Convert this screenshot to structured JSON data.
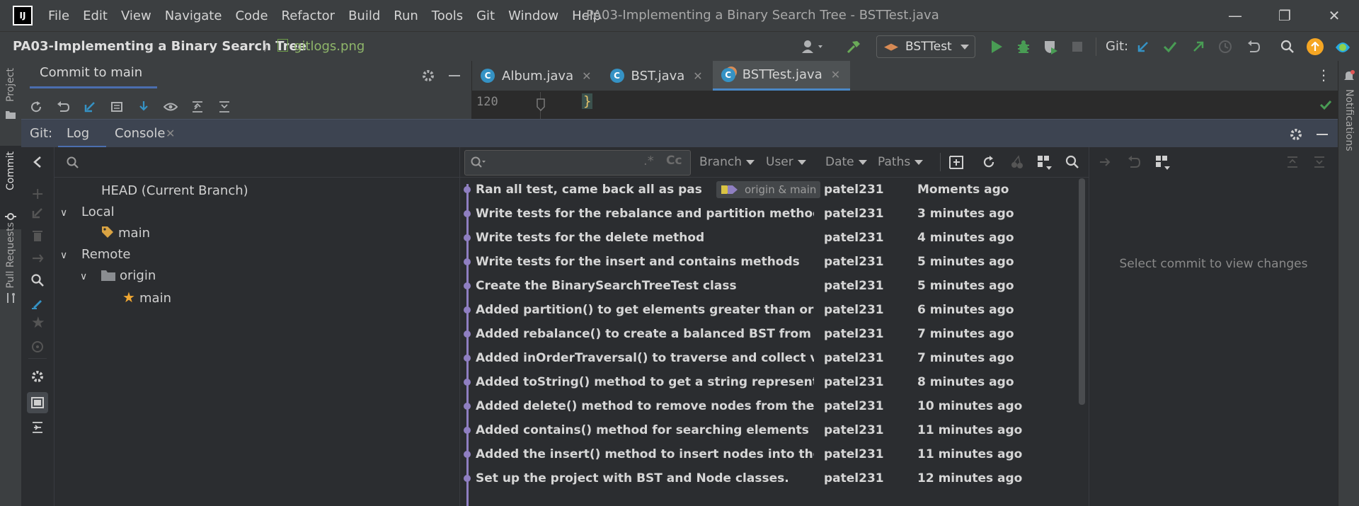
{
  "menubar": {
    "items": [
      "File",
      "Edit",
      "View",
      "Navigate",
      "Code",
      "Refactor",
      "Build",
      "Run",
      "Tools",
      "Git",
      "Window",
      "Help"
    ],
    "window_title": "PA03-Implementing a Binary Search Tree - BSTTest.java"
  },
  "navbar": {
    "project": "PA03-Implementing a Binary Search Tree",
    "file": "gitlogs.png",
    "run_config": "BSTTest",
    "git_label": "Git:"
  },
  "stripes": {
    "left": [
      "Project",
      "Commit",
      "Pull Requests"
    ],
    "right": [
      "Notifications"
    ]
  },
  "commit_panel": {
    "title": "Commit to main"
  },
  "editor": {
    "tabs": [
      {
        "label": "Album.java",
        "active": false
      },
      {
        "label": "BST.java",
        "active": false
      },
      {
        "label": "BSTTest.java",
        "active": true
      }
    ],
    "line_number": "120",
    "code": "}"
  },
  "git": {
    "label": "Git:",
    "tabs": [
      "Log",
      "Console"
    ],
    "branches": {
      "head": "HEAD (Current Branch)",
      "local": "Local",
      "local_main": "main",
      "remote": "Remote",
      "origin": "origin",
      "remote_main": "main"
    },
    "filters": [
      "Branch",
      "User",
      "Date",
      "Paths"
    ],
    "commits": [
      {
        "message": "Ran all test, came back all as passed",
        "refs": "origin & main",
        "author": "patel231",
        "time": "Moments ago"
      },
      {
        "message": "Write tests for the rebalance and partition methods, toString",
        "author": "patel231",
        "time": "3 minutes ago"
      },
      {
        "message": "Write tests for the delete method",
        "author": "patel231",
        "time": "4 minutes ago"
      },
      {
        "message": "Write tests for the insert and contains methods",
        "author": "patel231",
        "time": "5 minutes ago"
      },
      {
        "message": "Create the BinarySearchTreeTest class",
        "author": "patel231",
        "time": "5 minutes ago"
      },
      {
        "message": "Added partition() to get elements greater than or equal to",
        "author": "patel231",
        "time": "6 minutes ago"
      },
      {
        "message": "Added rebalance() to create a balanced BST from sorted values",
        "author": "patel231",
        "time": "7 minutes ago"
      },
      {
        "message": "Added inOrderTraversal() to traverse and collect values.",
        "author": "patel231",
        "time": "7 minutes ago"
      },
      {
        "message": "Added toString() method to get a string representation of",
        "author": "patel231",
        "time": "8 minutes ago"
      },
      {
        "message": "Added delete() method to remove nodes from the BST.",
        "author": "patel231",
        "time": "10 minutes ago"
      },
      {
        "message": "Added contains() method for searching elements in the BST",
        "author": "patel231",
        "time": "11 minutes ago"
      },
      {
        "message": "Added the insert() method to insert nodes into the BST.",
        "author": "patel231",
        "time": "11 minutes ago"
      },
      {
        "message": "Set up the project with BST and Node classes.",
        "author": "patel231",
        "time": "12 minutes ago"
      }
    ],
    "detail_placeholder": "Select commit to view changes"
  },
  "colors": {
    "accent": "#4b6eaf",
    "graph": "#8f7fc1",
    "run": "#499c54"
  }
}
